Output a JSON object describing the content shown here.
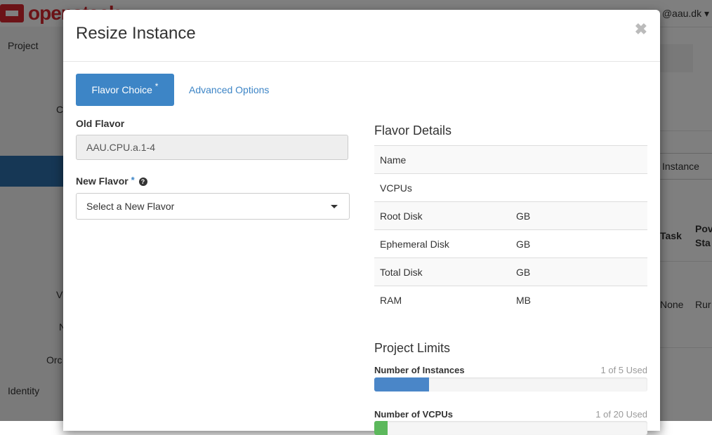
{
  "background": {
    "logo_text": "openstack",
    "user_suffix": "@aau.dk ▾",
    "sidebar": {
      "project": "Project",
      "item_c": "C",
      "item_v": "V",
      "item_n": "N",
      "item_orc": "Orc",
      "identity": "Identity"
    },
    "instance_button": "Instance",
    "table": {
      "task_header": "Task",
      "power_header_1": "Pov",
      "power_header_2": "Sta",
      "task_value": "None",
      "power_value": "Rur"
    }
  },
  "modal": {
    "title": "Resize Instance",
    "close_glyph": "✖",
    "tabs": [
      {
        "label": "Flavor Choice",
        "required_mark": "*",
        "active": true
      },
      {
        "label": "Advanced Options",
        "active": false
      }
    ],
    "old_flavor": {
      "label": "Old Flavor",
      "value": "AAU.CPU.a.1-4"
    },
    "new_flavor": {
      "label": "New Flavor",
      "required_mark": "*",
      "help_glyph": "?",
      "selected": "Select a New Flavor"
    },
    "flavor_details": {
      "title": "Flavor Details",
      "rows": [
        {
          "name": "Name",
          "unit": ""
        },
        {
          "name": "VCPUs",
          "unit": ""
        },
        {
          "name": "Root Disk",
          "unit": "GB"
        },
        {
          "name": "Ephemeral Disk",
          "unit": "GB"
        },
        {
          "name": "Total Disk",
          "unit": "GB"
        },
        {
          "name": "RAM",
          "unit": "MB"
        }
      ]
    },
    "project_limits": {
      "title": "Project Limits",
      "limits": [
        {
          "label": "Number of Instances",
          "used_text": "1 of 5 Used",
          "used": 1,
          "total": 5
        },
        {
          "label": "Number of VCPUs",
          "used_text": "1 of 20 Used",
          "used": 1,
          "total": 20
        }
      ]
    }
  },
  "colors": {
    "accent": "#3d85c6",
    "logo": "#d9272e",
    "bar_instances": "#4a86c8",
    "bar_vcpus": "#5cb85c"
  }
}
